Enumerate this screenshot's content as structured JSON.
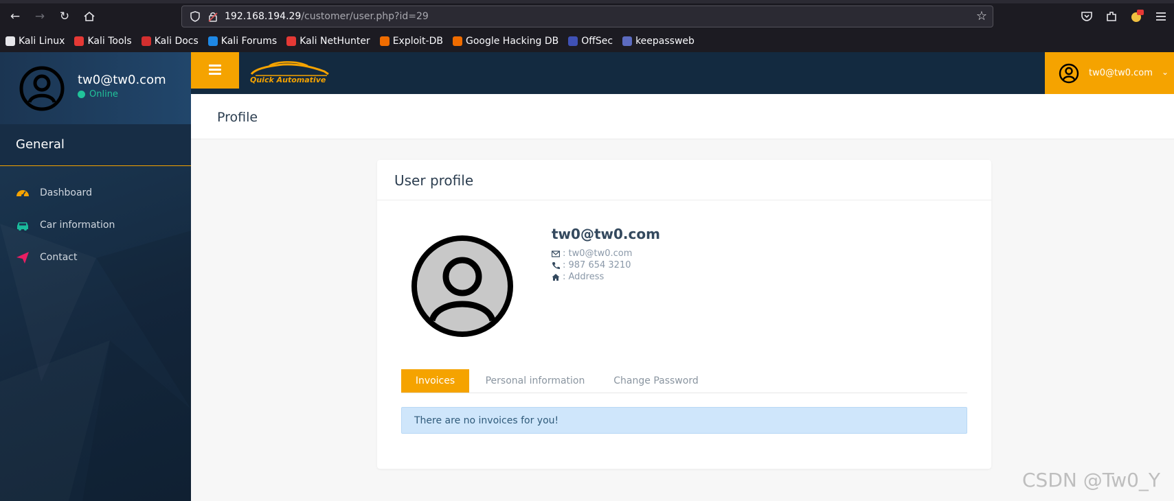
{
  "browser": {
    "url_host": "192.168.194.29",
    "url_path": "/customer/user.php?id=29",
    "bookmarks": [
      {
        "label": "Kali Linux",
        "color": "#e6e6ea"
      },
      {
        "label": "Kali Tools",
        "color": "#e53935"
      },
      {
        "label": "Kali Docs",
        "color": "#d32f2f"
      },
      {
        "label": "Kali Forums",
        "color": "#1e88e5"
      },
      {
        "label": "Kali NetHunter",
        "color": "#e53935"
      },
      {
        "label": "Exploit-DB",
        "color": "#ef6c00"
      },
      {
        "label": "Google Hacking DB",
        "color": "#ef6c00"
      },
      {
        "label": "OffSec",
        "color": "#3f51b5"
      },
      {
        "label": "keepassweb",
        "color": "#5c6bc0"
      }
    ]
  },
  "sidebar": {
    "user_name": "tw0@tw0.com",
    "status": "Online",
    "section": "General",
    "items": [
      {
        "label": "Dashboard",
        "icon": "dashboard-icon",
        "color": "#f5a300"
      },
      {
        "label": "Car information",
        "icon": "car-icon",
        "color": "#1abc9c"
      },
      {
        "label": "Contact",
        "icon": "paper-plane-icon",
        "color": "#e91e63"
      }
    ]
  },
  "header": {
    "logo_text": "Quick Automative",
    "user_name": "tw0@tw0.com",
    "accent": "#f5a300"
  },
  "page": {
    "title": "Profile"
  },
  "profile": {
    "card_title": "User profile",
    "name": "tw0@tw0.com",
    "email": ": tw0@tw0.com",
    "phone": ": 987 654 3210",
    "address": ": Address",
    "tabs": [
      "Invoices",
      "Personal information",
      "Change Password"
    ],
    "active_tab": "Invoices",
    "alert": "There are no invoices for you!"
  },
  "watermark": "CSDN @Tw0_Y"
}
